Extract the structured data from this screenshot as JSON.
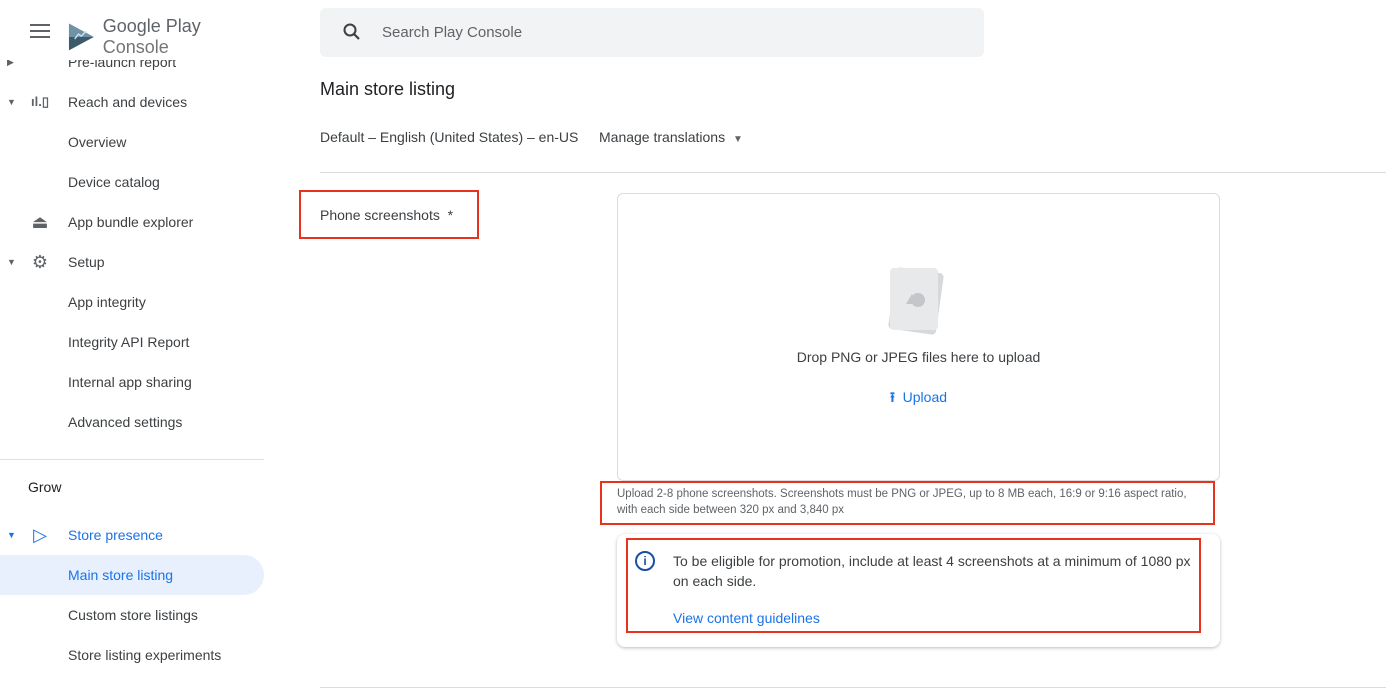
{
  "app": {
    "logo_main": "Google Play",
    "logo_sub": "Console"
  },
  "sidebar": {
    "items": [
      {
        "label": "Pre-launch report"
      },
      {
        "label": "Reach and devices"
      },
      {
        "label": "Overview"
      },
      {
        "label": "Device catalog"
      },
      {
        "label": "App bundle explorer"
      },
      {
        "label": "Setup"
      },
      {
        "label": "App integrity"
      },
      {
        "label": "Integrity API Report"
      },
      {
        "label": "Internal app sharing"
      },
      {
        "label": "Advanced settings"
      },
      {
        "label": "Grow"
      },
      {
        "label": "Store presence"
      },
      {
        "label": "Main store listing"
      },
      {
        "label": "Custom store listings"
      },
      {
        "label": "Store listing experiments"
      }
    ]
  },
  "search": {
    "placeholder": "Search Play Console"
  },
  "main": {
    "title": "Main store listing",
    "language": "Default – English (United States) – en-US",
    "manage_translations": "Manage translations",
    "phone_label": "Phone screenshots  *",
    "drop_text": "Drop PNG or JPEG files here to upload",
    "upload_label": "Upload",
    "help": "Upload 2-8 phone screenshots. Screenshots must be PNG or JPEG, up to 8 MB each, 16:9 or 9:16 aspect ratio, with each side between 320 px and 3,840 px",
    "promo_msg": "To be eligible for promotion, include at least 4 screenshots at a minimum of 1080 px on each side.",
    "promo_link": "View content guidelines"
  },
  "colors": {
    "accent": "#1a73e8",
    "highlight": "#e8321b"
  }
}
